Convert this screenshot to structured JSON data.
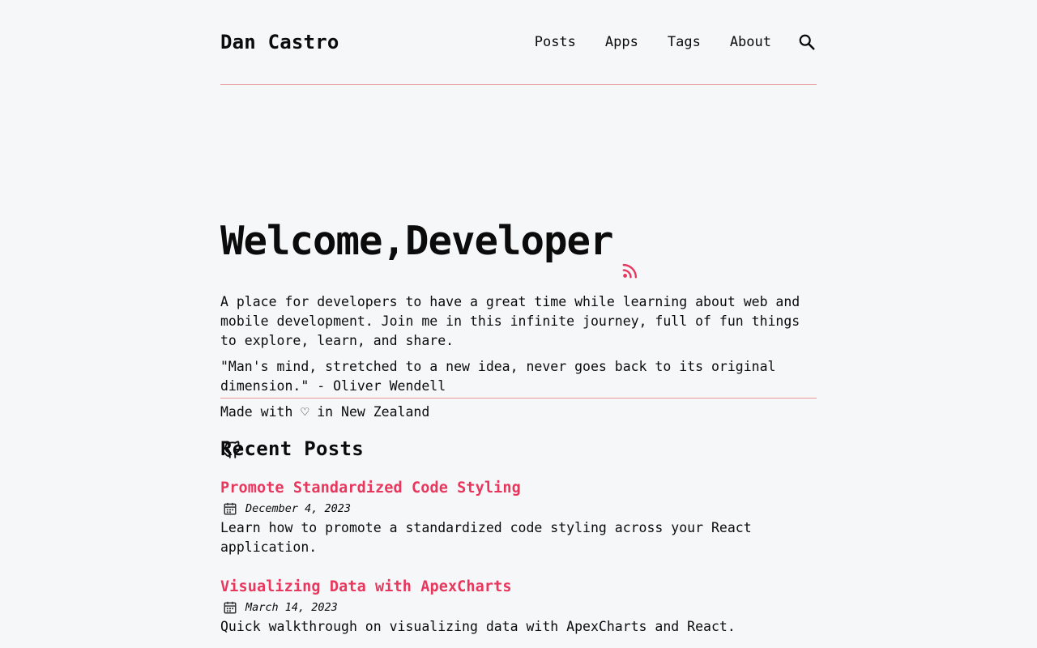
{
  "header": {
    "site_title": "Dan Castro",
    "nav": [
      "Posts",
      "Apps",
      "Tags",
      "About"
    ],
    "search_icon": "search-icon"
  },
  "hero": {
    "heading": "Welcome,Developer",
    "rss_icon": "rss-icon",
    "intro": "A place for developers to have a great time while learning about web and mobile development. Join me in this infinite journey, full of fun things to explore, learn, and share.",
    "quote": "\"Man's mind, stretched to a new idea, never goes back to its original dimension.\" - Oliver Wendell",
    "made_with": "Made with ♡ in New Zealand",
    "social_icon": "github-icon"
  },
  "recent": {
    "heading": "Recent Posts",
    "posts": [
      {
        "title": "Promote Standardized Code Styling",
        "date": "December 4, 2023",
        "excerpt": "Learn how to promote a standardized code styling across your React application."
      },
      {
        "title": "Visualizing Data with ApexCharts",
        "date": "March 14, 2023",
        "excerpt": "Quick walkthrough on visualizing data with ApexCharts and React."
      }
    ]
  },
  "colors": {
    "accent": "#e8365d",
    "divider": "#e89a9a",
    "background": "#f6f7f9",
    "text": "#0b0b0b"
  }
}
